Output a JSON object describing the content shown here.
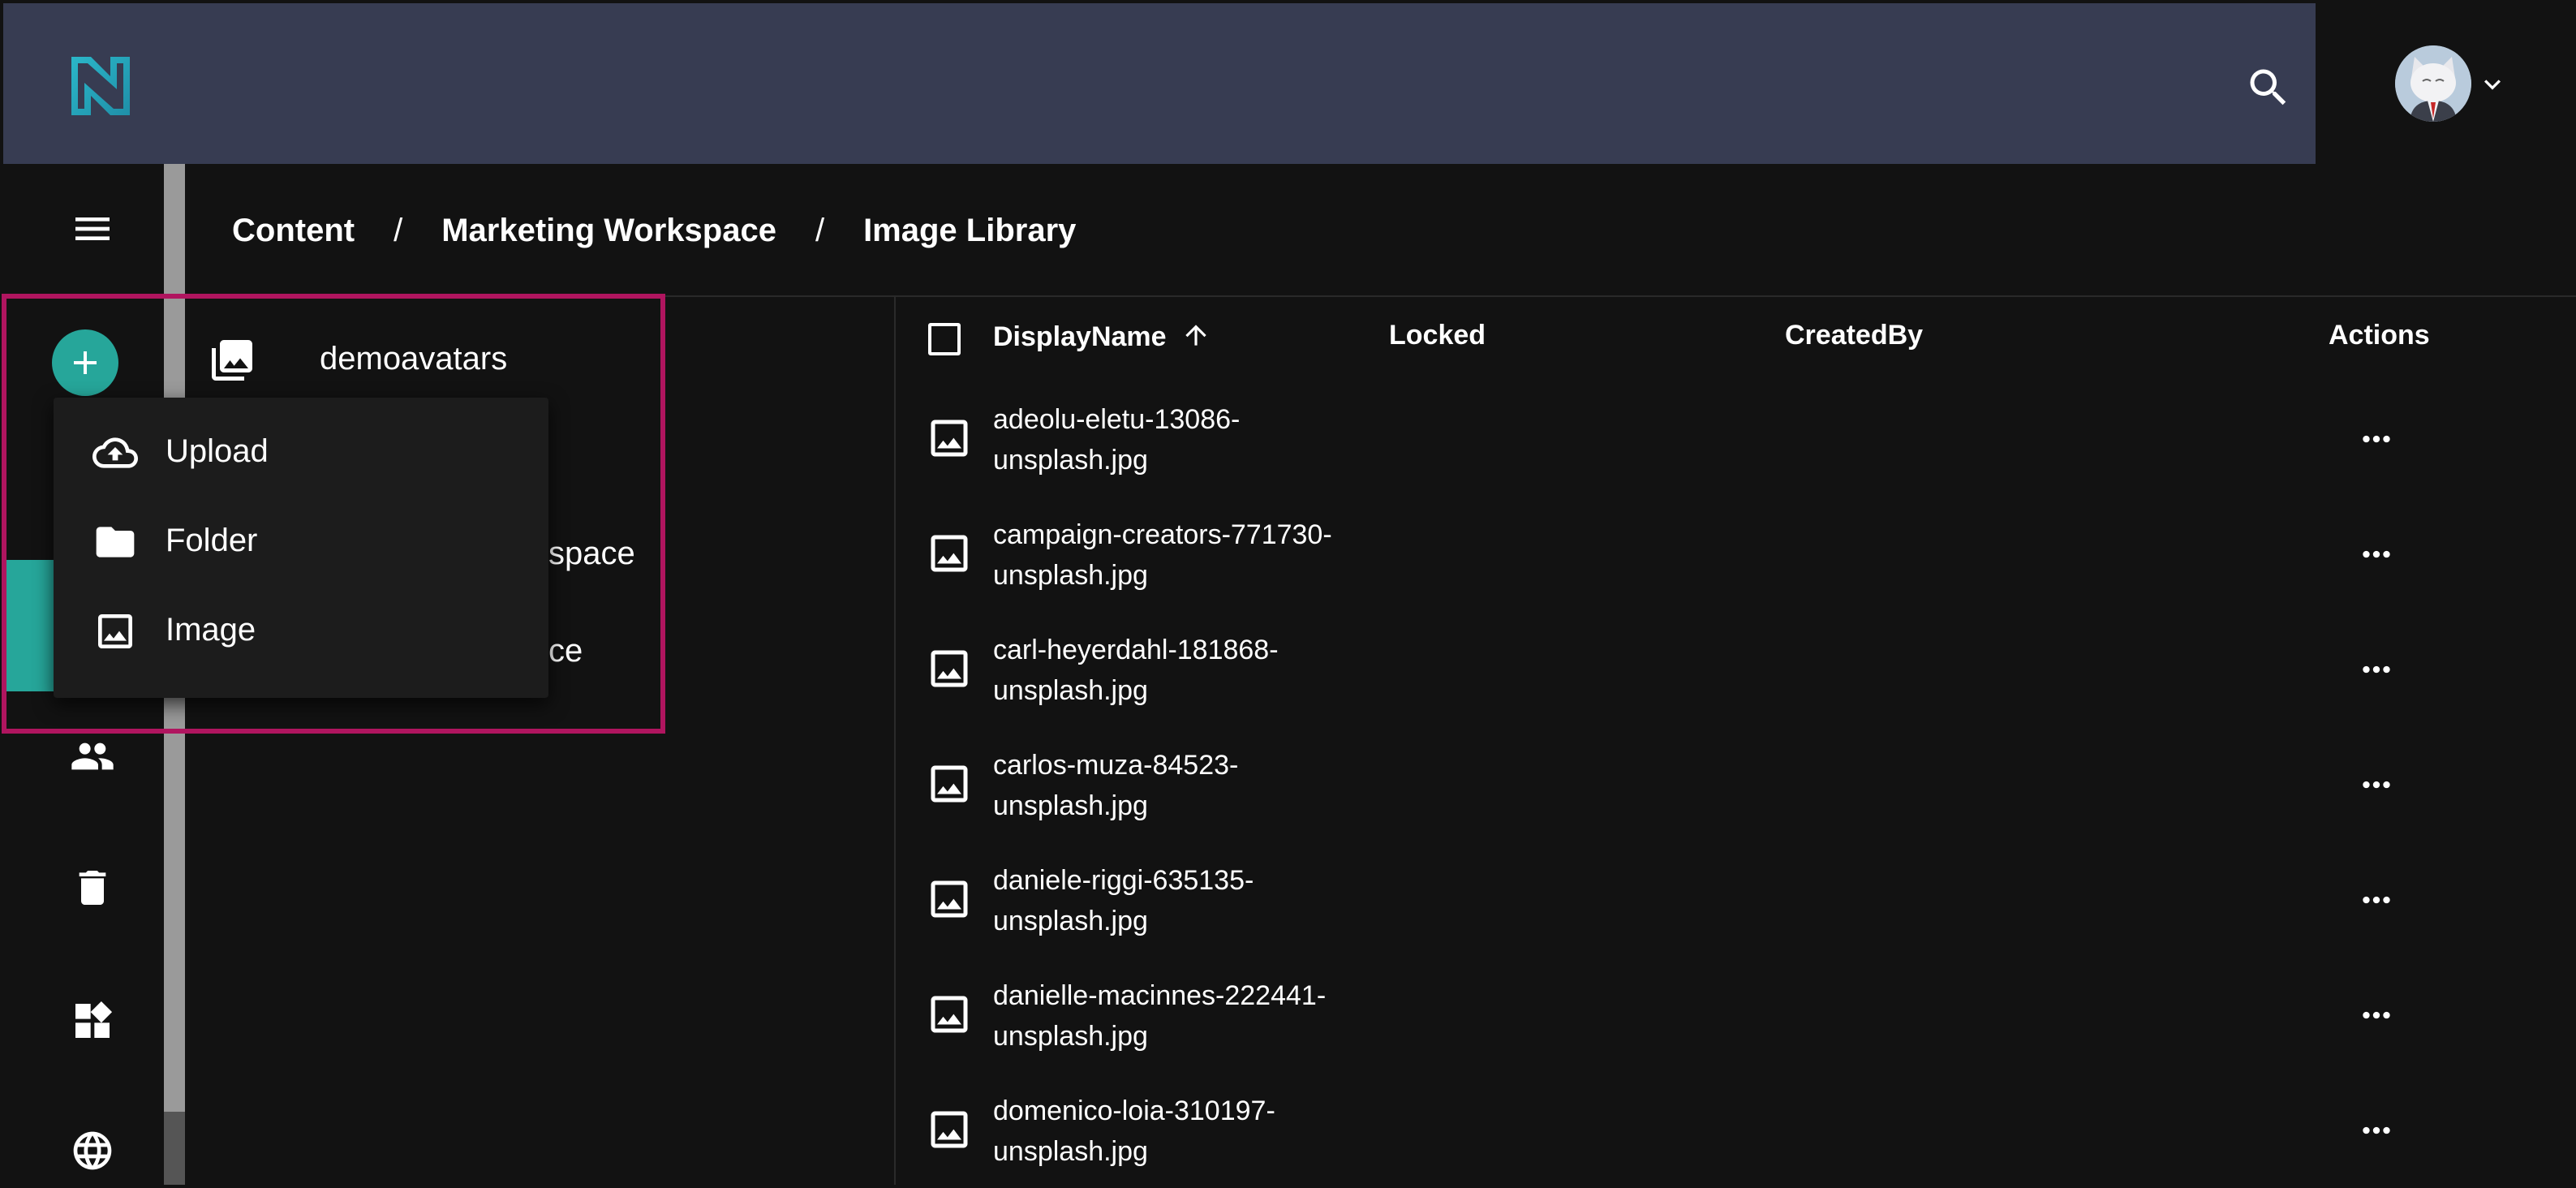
{
  "header": {
    "logo": "logo-icon",
    "search": "search-icon",
    "avatar": "cat-avatar",
    "account_menu": "chevron-down-icon"
  },
  "breadcrumb": {
    "items": [
      "Content",
      "Marketing Workspace",
      "Image Library"
    ],
    "separator": "/"
  },
  "tree": {
    "items": [
      {
        "label": "demoavatars",
        "icon": "photo-library-icon"
      },
      {
        "label": "space",
        "partial": true
      },
      {
        "label": "ce",
        "partial": true
      }
    ]
  },
  "create_menu": {
    "items": [
      {
        "label": "Upload",
        "icon": "cloud-upload-icon"
      },
      {
        "label": "Folder",
        "icon": "folder-icon"
      },
      {
        "label": "Image",
        "icon": "image-icon"
      }
    ]
  },
  "table": {
    "columns": {
      "name": "DisplayName",
      "locked": "Locked",
      "created_by": "CreatedBy",
      "actions": "Actions"
    },
    "sort": "ascending",
    "rows": [
      {
        "name": "adeolu-eletu-13086-\nunsplash.jpg"
      },
      {
        "name": "campaign-creators-771730-\nunsplash.jpg"
      },
      {
        "name": "carl-heyerdahl-181868-\nunsplash.jpg"
      },
      {
        "name": "carlos-muza-84523-\nunsplash.jpg"
      },
      {
        "name": "daniele-riggi-635135-\nunsplash.jpg"
      },
      {
        "name": "danielle-macinnes-222441-\nunsplash.jpg"
      },
      {
        "name": "domenico-loia-310197-\nunsplash.jpg"
      }
    ]
  },
  "colors": {
    "topbar": "#373c52",
    "accent": "#26a69a",
    "highlight": "#b0155f",
    "background": "#121212"
  }
}
